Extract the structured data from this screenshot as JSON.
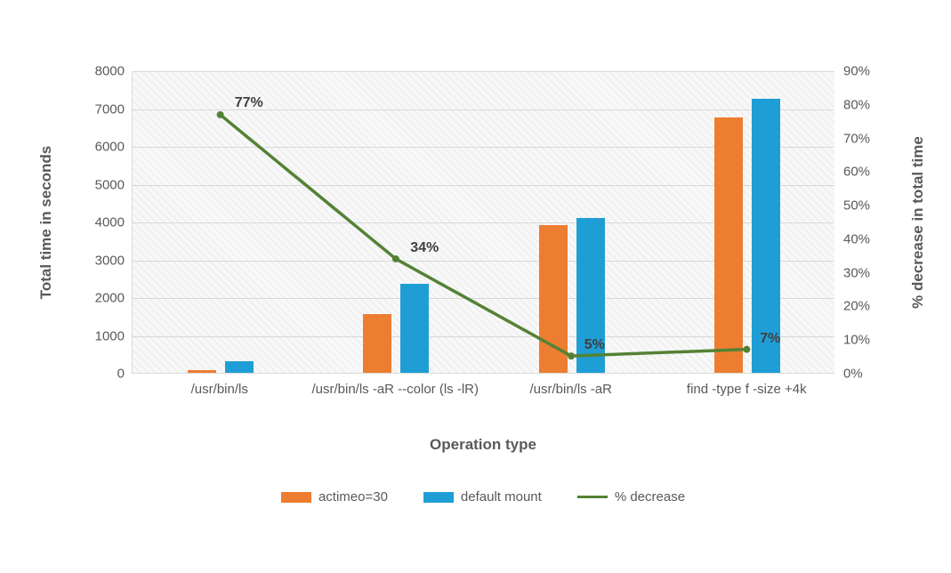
{
  "chart_data": {
    "type": "bar",
    "title": "",
    "xlabel": "Operation type",
    "ylabel_left": "Total time in seconds",
    "ylabel_right": "% decrease in total time",
    "categories": [
      "/usr/bin/ls",
      "/usr/bin/ls -aR --color (ls -lR)",
      "/usr/bin/ls -aR",
      "find -type f -size +4k"
    ],
    "series": [
      {
        "name": "actimeo=30",
        "type": "bar",
        "axis": "left",
        "color": "#ed7d31",
        "values": [
          80,
          1550,
          3900,
          6750
        ]
      },
      {
        "name": "default mount",
        "type": "bar",
        "axis": "left",
        "color": "#1f9ed6",
        "values": [
          300,
          2350,
          4100,
          7250
        ]
      },
      {
        "name": "% decrease",
        "type": "line",
        "axis": "right",
        "color": "#548235",
        "values": [
          77,
          34,
          5,
          7
        ]
      }
    ],
    "y_left": {
      "min": 0,
      "max": 8000,
      "step": 1000,
      "ticks": [
        0,
        1000,
        2000,
        3000,
        4000,
        5000,
        6000,
        7000,
        8000
      ]
    },
    "y_right": {
      "min": 0,
      "max": 90,
      "step": 10,
      "ticks": [
        0,
        10,
        20,
        30,
        40,
        50,
        60,
        70,
        80,
        90
      ],
      "format": "percent"
    },
    "data_labels": [
      "77%",
      "34%",
      "5%",
      "7%"
    ]
  },
  "legend": {
    "items": [
      {
        "label": "actimeo=30",
        "style": "bar-orange"
      },
      {
        "label": "default mount",
        "style": "bar-blue"
      },
      {
        "label": "% decrease",
        "style": "line-green"
      }
    ]
  }
}
